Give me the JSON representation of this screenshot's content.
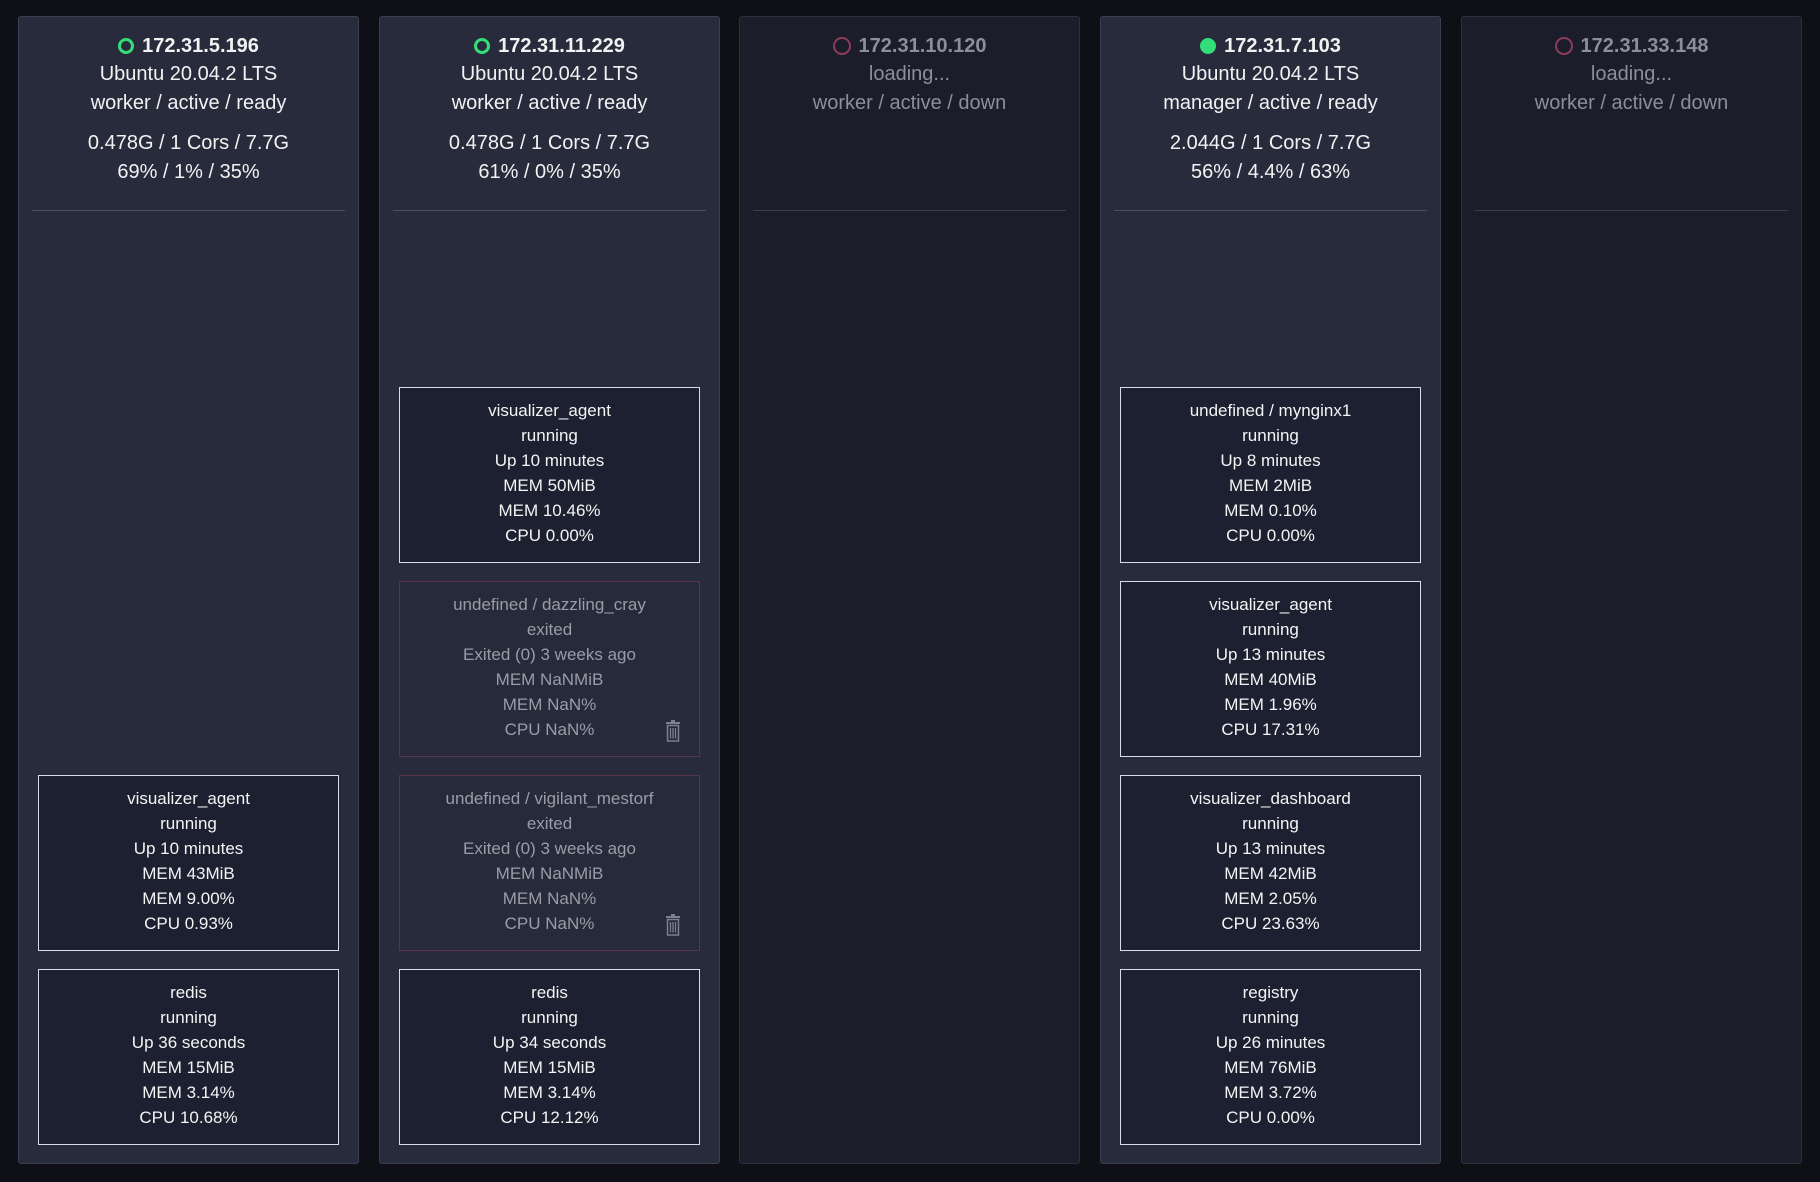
{
  "nodes": [
    {
      "ip": "172.31.5.196",
      "status": "ready",
      "os": "Ubuntu 20.04.2 LTS",
      "role_line": "worker / active / ready",
      "resources": "0.478G / 1 Cors / 7.7G",
      "usage": "69% / 1% / 35%",
      "containers": [
        {
          "name": "visualizer_agent",
          "state": "running",
          "uptime": "Up 10 minutes",
          "mem": "MEM 43MiB",
          "mem_pct": "MEM 9.00%",
          "cpu": "CPU 0.93%"
        },
        {
          "name": "redis",
          "state": "running",
          "uptime": "Up 36 seconds",
          "mem": "MEM 15MiB",
          "mem_pct": "MEM 3.14%",
          "cpu": "CPU 10.68%"
        }
      ]
    },
    {
      "ip": "172.31.11.229",
      "status": "ready",
      "os": "Ubuntu 20.04.2 LTS",
      "role_line": "worker / active / ready",
      "resources": "0.478G / 1 Cors / 7.7G",
      "usage": "61% / 0% / 35%",
      "containers": [
        {
          "name": "visualizer_agent",
          "state": "running",
          "uptime": "Up 10 minutes",
          "mem": "MEM 50MiB",
          "mem_pct": "MEM 10.46%",
          "cpu": "CPU 0.00%"
        },
        {
          "name": "undefined / dazzling_cray",
          "state": "exited",
          "uptime": "Exited (0) 3 weeks ago",
          "mem": "MEM NaNMiB",
          "mem_pct": "MEM NaN%",
          "cpu": "CPU NaN%"
        },
        {
          "name": "undefined / vigilant_mestorf",
          "state": "exited",
          "uptime": "Exited (0) 3 weeks ago",
          "mem": "MEM NaNMiB",
          "mem_pct": "MEM NaN%",
          "cpu": "CPU NaN%"
        },
        {
          "name": "redis",
          "state": "running",
          "uptime": "Up 34 seconds",
          "mem": "MEM 15MiB",
          "mem_pct": "MEM 3.14%",
          "cpu": "CPU 12.12%"
        }
      ]
    },
    {
      "ip": "172.31.10.120",
      "status": "down",
      "os": "loading...",
      "role_line": "worker / active / down",
      "resources": "",
      "usage": "",
      "containers": []
    },
    {
      "ip": "172.31.7.103",
      "status": "manager",
      "os": "Ubuntu 20.04.2 LTS",
      "role_line": "manager / active / ready",
      "resources": "2.044G / 1 Cors / 7.7G",
      "usage": "56% / 4.4% / 63%",
      "containers": [
        {
          "name": "undefined / mynginx1",
          "state": "running",
          "uptime": "Up 8 minutes",
          "mem": "MEM 2MiB",
          "mem_pct": "MEM 0.10%",
          "cpu": "CPU 0.00%"
        },
        {
          "name": "visualizer_agent",
          "state": "running",
          "uptime": "Up 13 minutes",
          "mem": "MEM 40MiB",
          "mem_pct": "MEM 1.96%",
          "cpu": "CPU 17.31%"
        },
        {
          "name": "visualizer_dashboard",
          "state": "running",
          "uptime": "Up 13 minutes",
          "mem": "MEM 42MiB",
          "mem_pct": "MEM 2.05%",
          "cpu": "CPU 23.63%"
        },
        {
          "name": "registry",
          "state": "running",
          "uptime": "Up 26 minutes",
          "mem": "MEM 76MiB",
          "mem_pct": "MEM 3.72%",
          "cpu": "CPU 0.00%"
        }
      ]
    },
    {
      "ip": "172.31.33.148",
      "status": "down",
      "os": "loading...",
      "role_line": "worker / active / down",
      "resources": "",
      "usage": "",
      "containers": []
    }
  ],
  "colors": {
    "ready": "#33dd77",
    "down": "#8f3b5a",
    "background": "#0e1016",
    "node_panel": "#272b3c"
  },
  "icons": {
    "status_ready": "ring-icon",
    "status_manager": "filled-dot-icon",
    "status_down": "ring-icon",
    "remove_container": "trash-icon"
  }
}
